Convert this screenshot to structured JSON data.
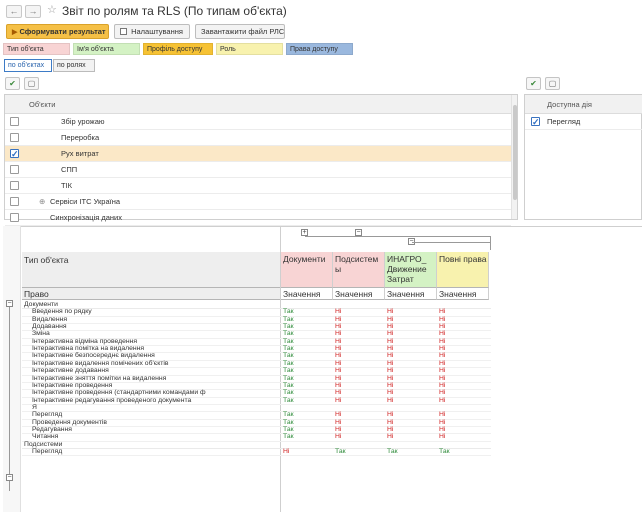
{
  "header": {
    "title": "Звіт по ролям та RLS (По типам об'єкта)",
    "back_label": "←",
    "forward_label": "→",
    "star": "☆"
  },
  "toolbar": {
    "generate_label": "Сформувати результат",
    "settings_label": "Налаштування",
    "load_file_label": "Завантажити файл РЛС"
  },
  "legend": [
    {
      "label": "Тип об'єкта",
      "color": "#f8d4d4"
    },
    {
      "label": "Ім'я об'єкта",
      "color": "#d4f2c4"
    },
    {
      "label": "Профіль доступу",
      "color": "#f6c234"
    },
    {
      "label": "Роль",
      "color": "#f8f2ae"
    },
    {
      "label": "Права доступу",
      "color": "#9ab8de"
    }
  ],
  "toggles": {
    "by_objects": "по об'єктах",
    "by_roles": "по ролях"
  },
  "objects": {
    "header": "Об'єкти",
    "rows": [
      {
        "label": "Збір урожаю",
        "checked": false,
        "indent": 2
      },
      {
        "label": "Переробка",
        "checked": false,
        "indent": 2
      },
      {
        "label": "Рух витрат",
        "checked": true,
        "indent": 2,
        "selected": true
      },
      {
        "label": "СПП",
        "checked": false,
        "indent": 2
      },
      {
        "label": "ТІК",
        "checked": false,
        "indent": 2
      },
      {
        "label": "Сервіси ІТС Україна",
        "checked": false,
        "indent": 1,
        "expand": "⊕"
      },
      {
        "label": "Синхронізація даних",
        "checked": false,
        "indent": 1
      }
    ]
  },
  "access": {
    "header": "Доступна дія",
    "rows": [
      {
        "label": "Перегляд",
        "checked": true
      }
    ]
  },
  "report": {
    "col_header_left": "Тип об'єкта",
    "col_header_right": "Право",
    "columns": [
      {
        "title": "Документи",
        "bg": "#f8d4d4"
      },
      {
        "title": "Подсистем ы",
        "bg": "#f8d4d4"
      },
      {
        "title": "ИНАГРО_ Движение Затрат",
        "bg": "#d4f2c4"
      },
      {
        "title": "Повні права",
        "bg": "#f8f2ae"
      }
    ],
    "value_label": "Значення",
    "groups": [
      {
        "name": "Документи",
        "rows": [
          {
            "label": "Введення по рядку",
            "v": [
              "Так",
              "Ні",
              "Ні",
              "Ні"
            ]
          },
          {
            "label": "Видалення",
            "v": [
              "Так",
              "Ні",
              "Ні",
              "Ні"
            ]
          },
          {
            "label": "Додавання",
            "v": [
              "Так",
              "Ні",
              "Ні",
              "Ні"
            ]
          },
          {
            "label": "Зміна",
            "v": [
              "Так",
              "Ні",
              "Ні",
              "Ні"
            ]
          },
          {
            "label": "Інтерактивна відміна проведення",
            "v": [
              "Так",
              "Ні",
              "Ні",
              "Ні"
            ]
          },
          {
            "label": "Інтерактивна помітка на видалення",
            "v": [
              "Так",
              "Ні",
              "Ні",
              "Ні"
            ]
          },
          {
            "label": "Інтерактивне безпосереднє видалення",
            "v": [
              "Так",
              "Ні",
              "Ні",
              "Ні"
            ]
          },
          {
            "label": "Інтерактивне видалення помічених об'єктів",
            "v": [
              "Так",
              "Ні",
              "Ні",
              "Ні"
            ]
          },
          {
            "label": "Інтерактивне додавання",
            "v": [
              "Так",
              "Ні",
              "Ні",
              "Ні"
            ]
          },
          {
            "label": "Інтерактивне зняття помітки на видалення",
            "v": [
              "Так",
              "Ні",
              "Ні",
              "Ні"
            ]
          },
          {
            "label": "Інтерактивне проведення",
            "v": [
              "Так",
              "Ні",
              "Ні",
              "Ні"
            ]
          },
          {
            "label": "Інтерактивне проведення (стандартними командами ф",
            "v": [
              "Так",
              "Ні",
              "Ні",
              "Ні"
            ]
          },
          {
            "label": "Інтерактивне редагування проведеного документа",
            "v": [
              "Так",
              "Ні",
              "Ні",
              "Ні"
            ]
          },
          {
            "label": "Я",
            "v": [
              "",
              "",
              "",
              ""
            ]
          },
          {
            "label": "Перегляд",
            "v": [
              "Так",
              "Ні",
              "Ні",
              "Ні"
            ]
          },
          {
            "label": "Проведення документів",
            "v": [
              "Так",
              "Ні",
              "Ні",
              "Ні"
            ]
          },
          {
            "label": "Редагування",
            "v": [
              "Так",
              "Ні",
              "Ні",
              "Ні"
            ]
          },
          {
            "label": "Читання",
            "v": [
              "Так",
              "Ні",
              "Ні",
              "Ні"
            ]
          }
        ]
      },
      {
        "name": "Подсистеми",
        "rows": [
          {
            "label": "Перегляд",
            "v": [
              "Ні",
              "Так",
              "Так",
              "Так"
            ]
          }
        ]
      }
    ]
  }
}
